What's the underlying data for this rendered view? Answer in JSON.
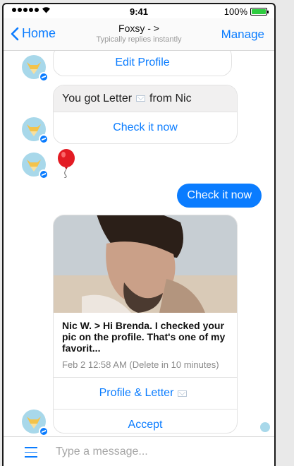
{
  "status_bar": {
    "time": "9:41",
    "battery": "100%",
    "battery_level": 1.0
  },
  "nav": {
    "back_label": "Home",
    "title": "Foxsy - >",
    "subtitle": "Typically replies instantly",
    "manage_label": "Manage"
  },
  "messages": {
    "edit_profile_button": "Edit Profile",
    "letter_text_before": "You got Letter",
    "letter_text_after": "from Nic",
    "check_it_now_button": "Check it now",
    "outgoing_text": "Check it now",
    "card": {
      "title": "Nic W. > Hi Brenda.  I checked your pic on the profile. That's one of my favorit...",
      "time": "Feb 2 12:58 AM (Delete in 10 minutes)",
      "profile_letter_button": "Profile & Letter",
      "accept_button": "Accept"
    }
  },
  "composer": {
    "placeholder": "Type a message..."
  },
  "colors": {
    "accent": "#0a7cff",
    "bubble_gray": "#f1f0f0"
  },
  "icons": [
    "back-chevron-icon",
    "signal-dots-icon",
    "wifi-icon",
    "battery-icon",
    "messenger-badge-icon",
    "balloon-icon",
    "mail-icon",
    "menu-icon"
  ]
}
